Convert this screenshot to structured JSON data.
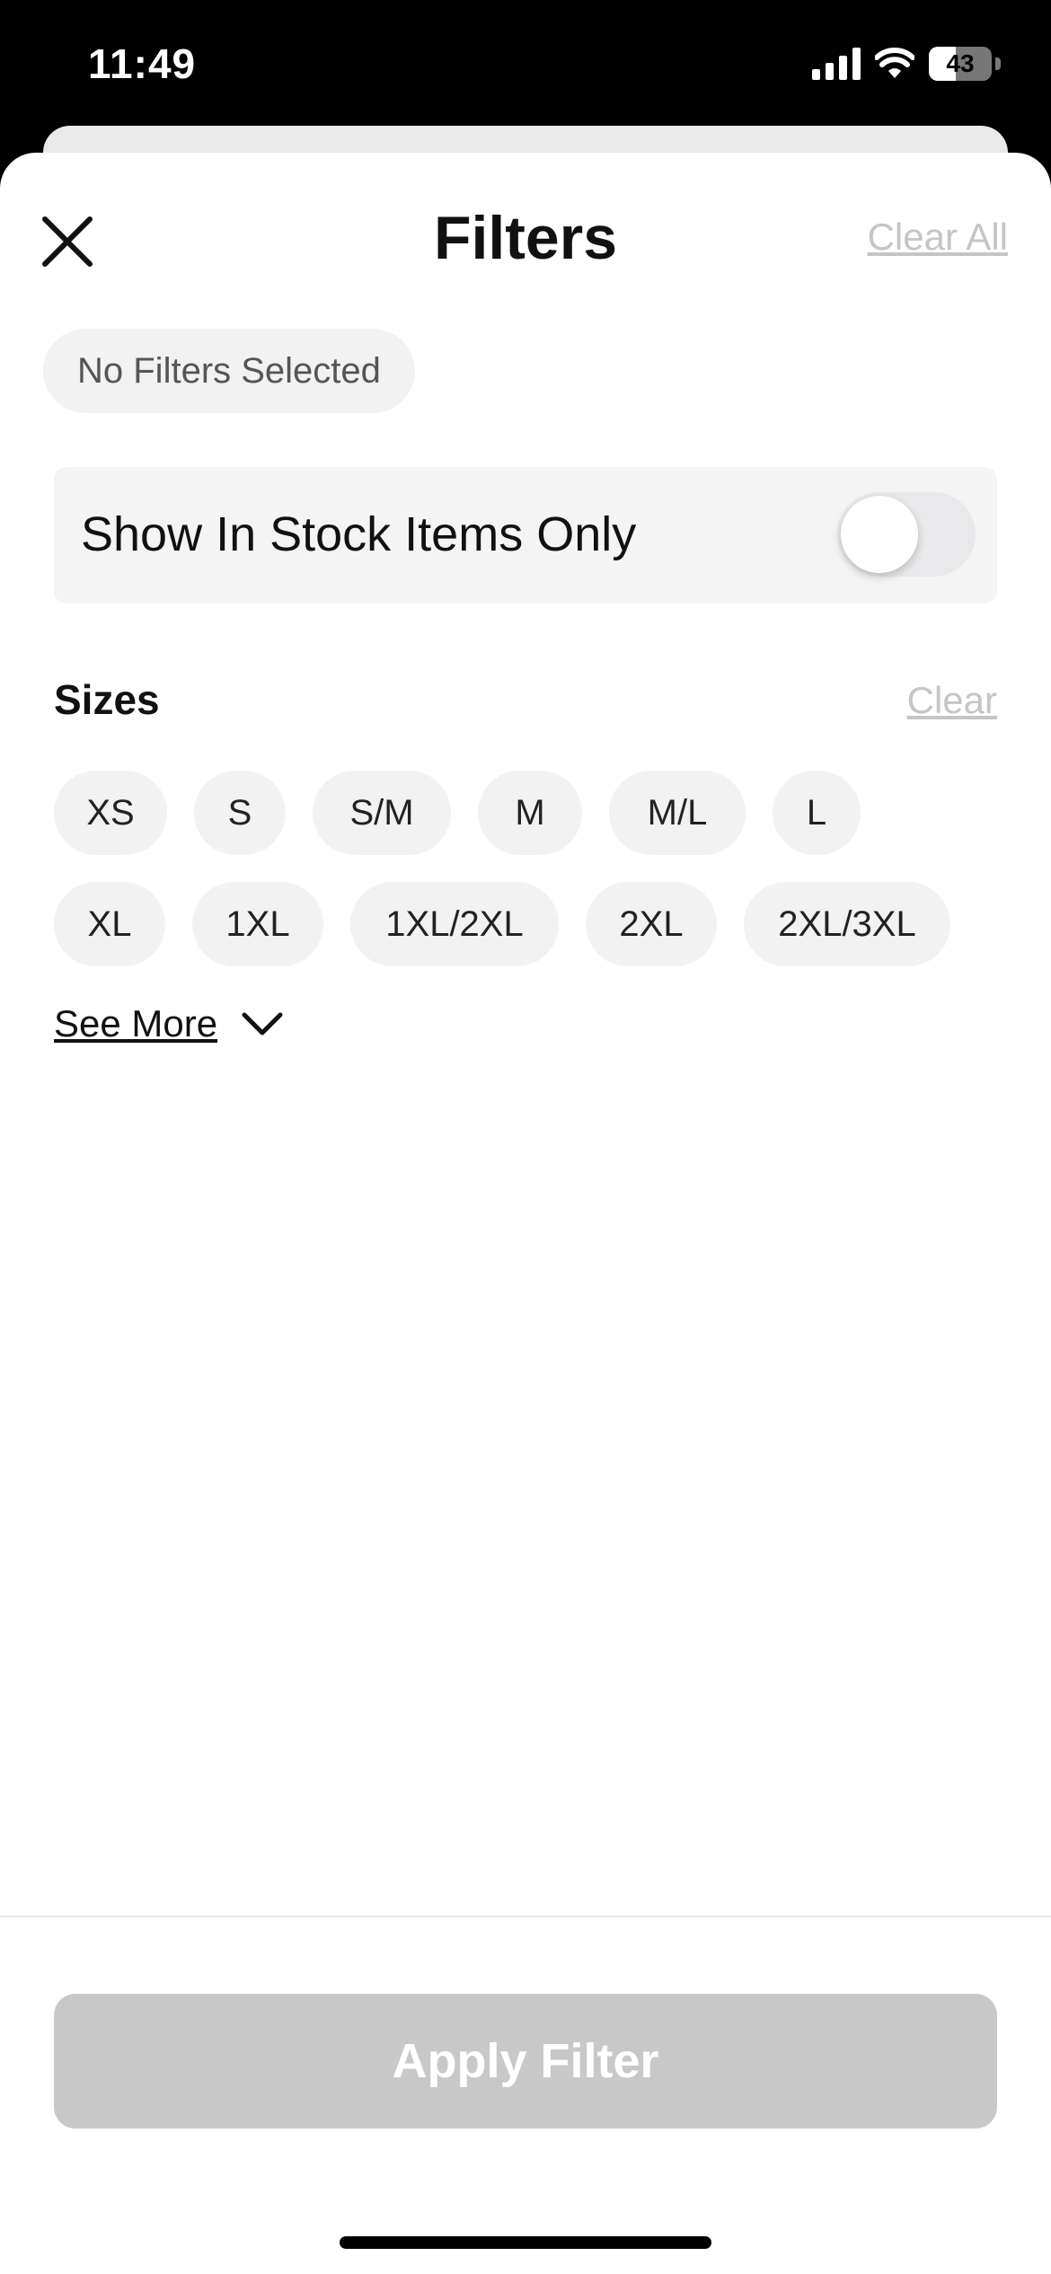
{
  "status_bar": {
    "time": "11:49",
    "battery": "43",
    "battery_level": 0.43
  },
  "header": {
    "title": "Filters",
    "clear_all": "Clear All"
  },
  "selected_filters": {
    "empty_label": "No Filters Selected"
  },
  "stock_toggle": {
    "label": "Show In Stock Items Only",
    "enabled": false
  },
  "sizes": {
    "title": "Sizes",
    "clear_label": "Clear",
    "options": [
      "XS",
      "S",
      "S/M",
      "M",
      "M/L",
      "L",
      "XL",
      "1XL",
      "1XL/2XL",
      "2XL",
      "2XL/3XL"
    ],
    "see_more": "See More"
  },
  "footer": {
    "apply_label": "Apply Filter"
  },
  "colors": {
    "chip_bg": "#f2f2f2",
    "disabled_button": "#c8c8c8",
    "link_muted": "#c5c5c5"
  }
}
